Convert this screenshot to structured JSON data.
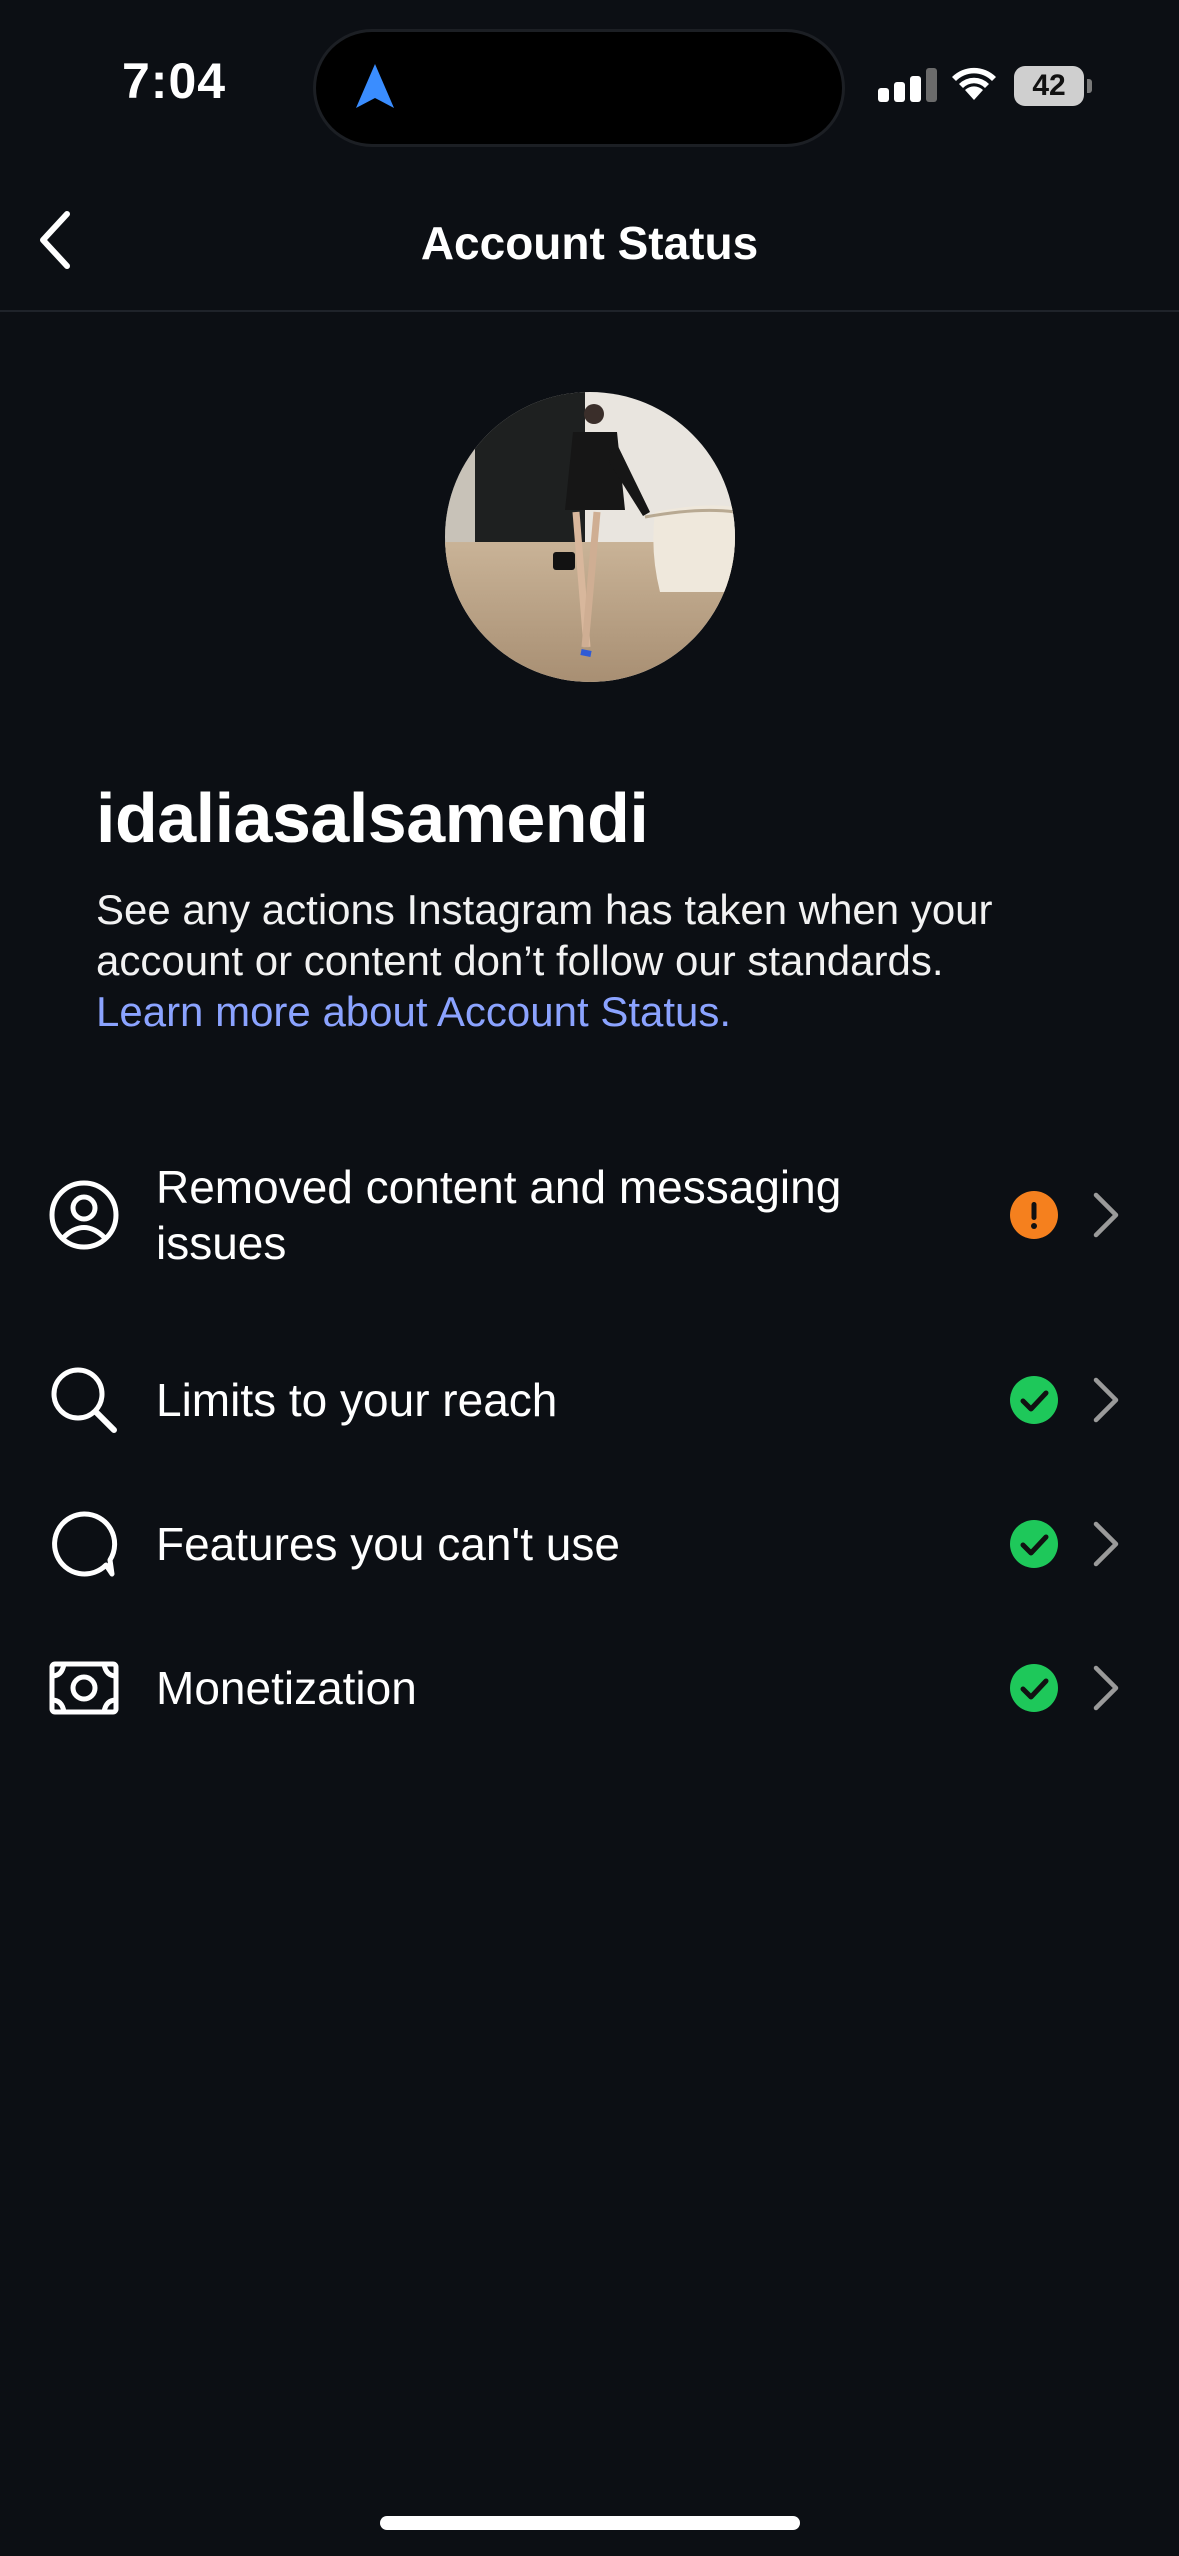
{
  "status_bar": {
    "time": "7:04",
    "battery": "42"
  },
  "header": {
    "title": "Account Status"
  },
  "profile": {
    "username": "idaliasalsamendi",
    "description": "See any actions Instagram has taken when your account or content don’t follow our standards.",
    "learn_more": "Learn more about Account Status."
  },
  "status_items": [
    {
      "label": "Removed content and messaging issues",
      "icon": "user-circle-icon",
      "status": "warning"
    },
    {
      "label": "Limits to your reach",
      "icon": "search-icon",
      "status": "ok"
    },
    {
      "label": "Features you can't use",
      "icon": "speech-bubble-icon",
      "status": "ok"
    },
    {
      "label": "Monetization",
      "icon": "banknote-icon",
      "status": "ok"
    }
  ],
  "colors": {
    "background": "#0c0f14",
    "link": "#8ba3ff",
    "warning": "#f5801e",
    "ok": "#1ec85a",
    "nav_arrow": "#3a8dff"
  }
}
